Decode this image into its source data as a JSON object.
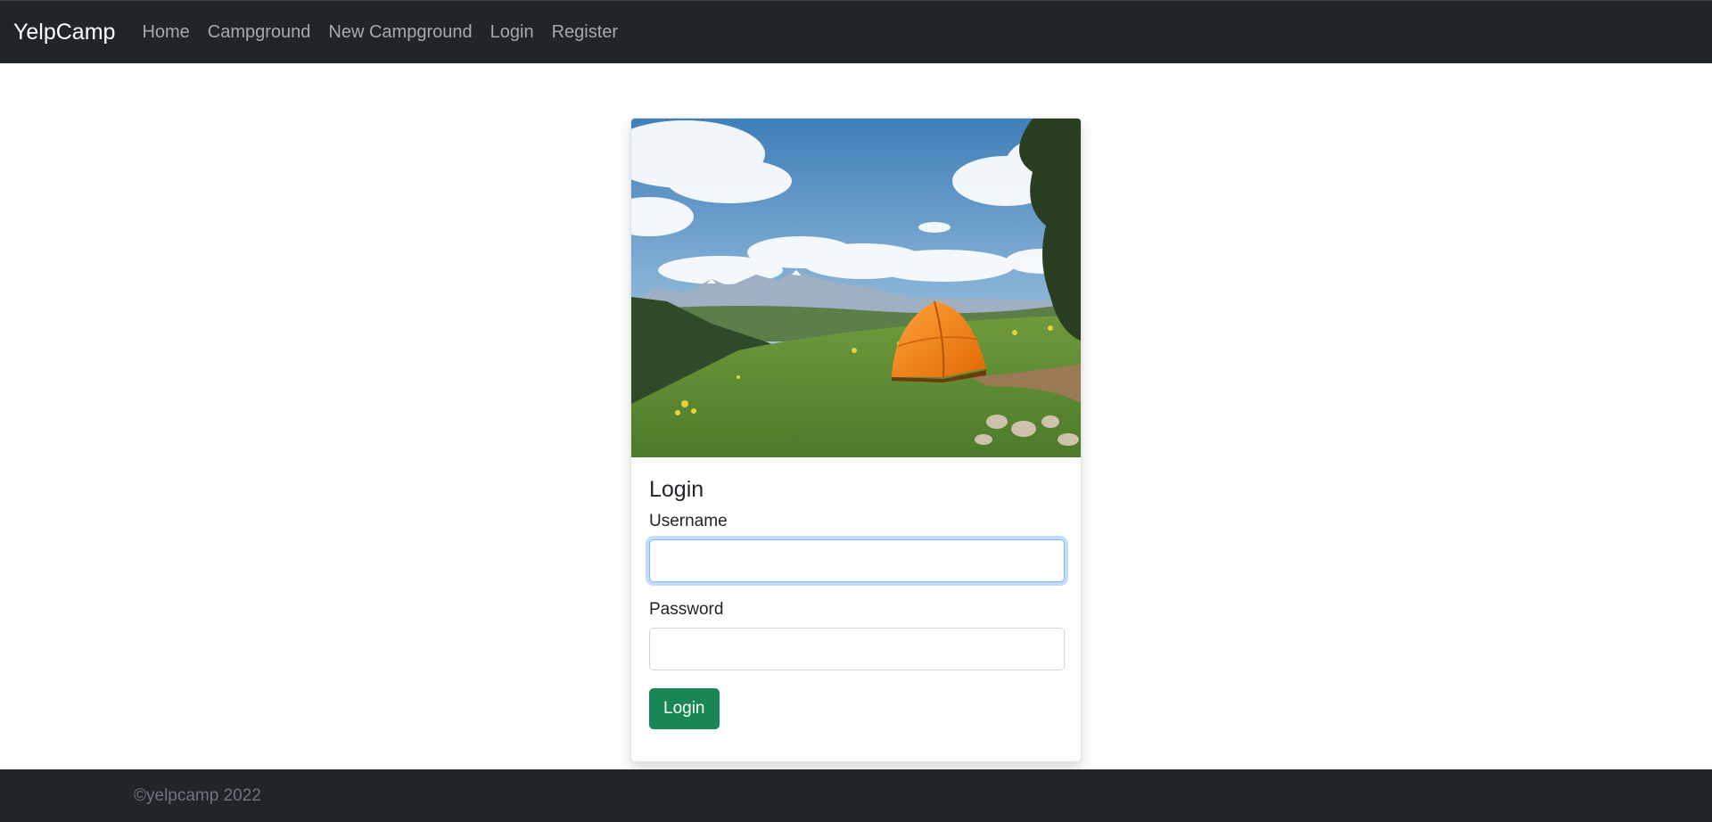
{
  "navbar": {
    "brand": "YelpCamp",
    "links": [
      {
        "label": "Home"
      },
      {
        "label": "Campground"
      },
      {
        "label": "New Campground"
      },
      {
        "label": "Login"
      },
      {
        "label": "Register"
      }
    ]
  },
  "login_card": {
    "title": "Login",
    "username": {
      "label": "Username",
      "value": ""
    },
    "password": {
      "label": "Password",
      "value": ""
    },
    "submit_label": "Login"
  },
  "footer": {
    "text": "©yelpcamp 2022"
  },
  "colors": {
    "navbar_bg": "#212529",
    "success": "#198754",
    "tent": "#f07f0f"
  }
}
